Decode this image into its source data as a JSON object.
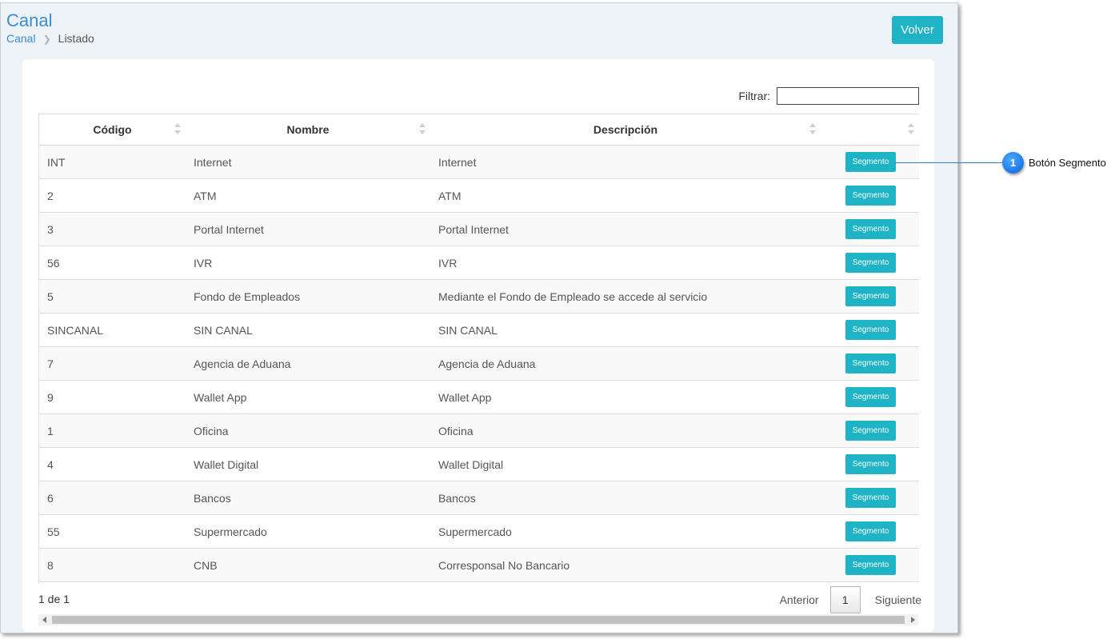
{
  "header": {
    "title": "Canal",
    "breadcrumb": [
      "Canal",
      "Listado"
    ],
    "back_label": "Volver"
  },
  "filter": {
    "label": "Filtrar:",
    "value": "",
    "placeholder": ""
  },
  "table": {
    "columns": [
      "Código",
      "Nombre",
      "Descripción",
      ""
    ],
    "action_label": "Segmento",
    "rows": [
      {
        "codigo": "INT",
        "nombre": "Internet",
        "descripcion": "Internet"
      },
      {
        "codigo": "2",
        "nombre": "ATM",
        "descripcion": "ATM"
      },
      {
        "codigo": "3",
        "nombre": "Portal Internet",
        "descripcion": "Portal Internet"
      },
      {
        "codigo": "56",
        "nombre": "IVR",
        "descripcion": "IVR"
      },
      {
        "codigo": "5",
        "nombre": "Fondo de Empleados",
        "descripcion": "Mediante el Fondo de Empleado se accede al servicio"
      },
      {
        "codigo": "SINCANAL",
        "nombre": "SIN CANAL",
        "descripcion": "SIN CANAL"
      },
      {
        "codigo": "7",
        "nombre": "Agencia de Aduana",
        "descripcion": "Agencia de Aduana"
      },
      {
        "codigo": "9",
        "nombre": "Wallet App",
        "descripcion": "Wallet App"
      },
      {
        "codigo": "1",
        "nombre": "Oficina",
        "descripcion": "Oficina"
      },
      {
        "codigo": "4",
        "nombre": "Wallet Digital",
        "descripcion": "Wallet Digital"
      },
      {
        "codigo": "6",
        "nombre": "Bancos",
        "descripcion": "Bancos"
      },
      {
        "codigo": "55",
        "nombre": "Supermercado",
        "descripcion": "Supermercado"
      },
      {
        "codigo": "8",
        "nombre": "CNB",
        "descripcion": "Corresponsal No Bancario"
      }
    ]
  },
  "footer": {
    "page_info": "1 de 1",
    "prev_label": "Anterior",
    "current_page": "1",
    "next_label": "Siguiente"
  },
  "callout": {
    "number": "1",
    "text": "Botón Segmento"
  },
  "colors": {
    "accent": "#1fb3c6",
    "title": "#3c8dce",
    "callout": "#0a62d8"
  }
}
